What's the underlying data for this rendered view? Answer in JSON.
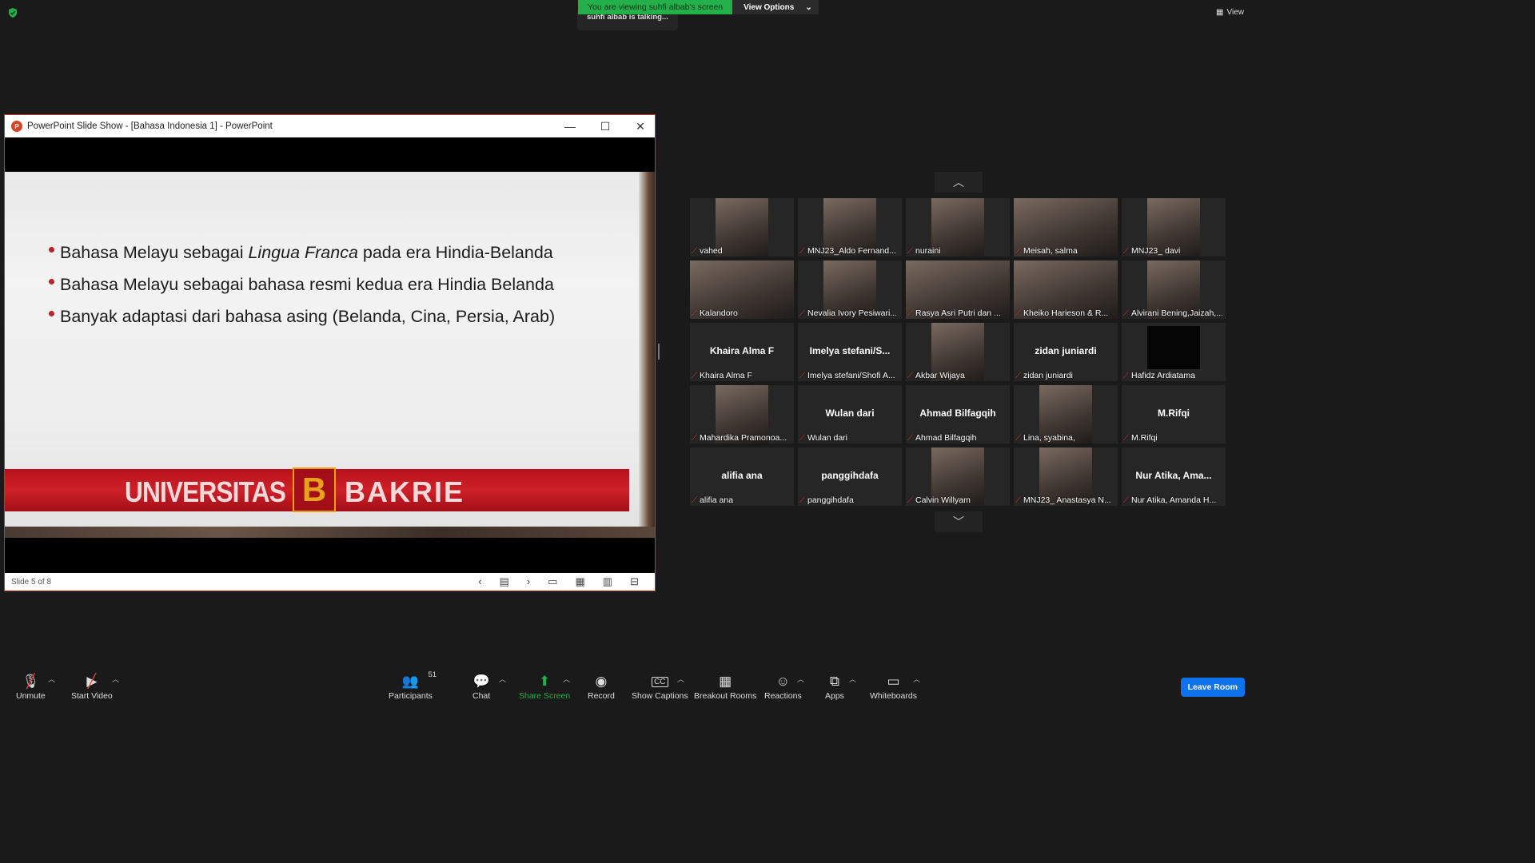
{
  "colors": {
    "share_green": "#23b04a",
    "leave_blue": "#0e72ed",
    "mute_red": "#e0443c",
    "bg": "#1a1a1a"
  },
  "top": {
    "viewing_text": "You are viewing suhfi albab's screen",
    "view_options": "View Options",
    "talking_text": "suhfi albab is talking...",
    "view_label": "View"
  },
  "ppt": {
    "title": "PowerPoint Slide Show - [Bahasa Indonesia 1] - PowerPoint",
    "logo_letter": "P",
    "slide_status": "Slide 5 of 8",
    "bullets": [
      {
        "pre": "Bahasa Melayu sebagai ",
        "italic": "Lingua Franca",
        "post": " pada era Hindia-Belanda"
      },
      {
        "pre": "Bahasa Melayu sebagai bahasa  resmi kedua era Hindia Belanda",
        "italic": "",
        "post": ""
      },
      {
        "pre": "Banyak adaptasi dari bahasa asing (Belanda, Cina, Persia, Arab)",
        "italic": "",
        "post": ""
      }
    ],
    "banner_left": "UNIVERSITAS",
    "banner_logo": "B",
    "banner_right": "BAKRIE"
  },
  "participants": [
    {
      "label": "vahed",
      "video": true
    },
    {
      "label": "MNJ23_Aldo Fernand...",
      "video": true
    },
    {
      "label": "nuraini",
      "video": true
    },
    {
      "label": "Meisah, salma",
      "video": true,
      "wide": true
    },
    {
      "label": "MNJ23_ davi",
      "video": true
    },
    {
      "label": "Kalandoro",
      "video": true,
      "wide": true
    },
    {
      "label": "Nevalia Ivory Pesiwari...",
      "video": true
    },
    {
      "label": "Rasya Asri Putri dan ...",
      "video": true,
      "wide": true
    },
    {
      "label": "Kheiko Harieson & R...",
      "video": true,
      "wide": true
    },
    {
      "label": "Alvirani Bening,Jaizah,...",
      "video": true
    },
    {
      "label": "Khaira Alma F",
      "name": "Khaira Alma F"
    },
    {
      "label": "Imelya stefani/Shofi A...",
      "name": "Imelya  stefani/S..."
    },
    {
      "label": "Akbar Wijaya",
      "video": true
    },
    {
      "label": "zidan juniardi",
      "name": "zidan juniardi"
    },
    {
      "label": "Hafidz Ardiatama",
      "black": true
    },
    {
      "label": "Mahardika Pramonoa...",
      "video": true
    },
    {
      "label": "Wulan dari",
      "name": "Wulan dari"
    },
    {
      "label": "Ahmad Bilfagqih",
      "name": "Ahmad Bilfagqih"
    },
    {
      "label": "Lina, syabina,",
      "video": true
    },
    {
      "label": "M.Rifqi",
      "name": "M.Rifqi"
    },
    {
      "label": "alifia ana",
      "name": "alifia ana"
    },
    {
      "label": "panggihdafa",
      "name": "panggihdafa"
    },
    {
      "label": "Calvin Willyam",
      "video": true
    },
    {
      "label": "MNJ23_ Anastasya N...",
      "video": true
    },
    {
      "label": "Nur Atika, Amanda H...",
      "name": "Nur Atika, Ama..."
    }
  ],
  "toolbar": {
    "unmute": "Unmute",
    "start_video": "Start Video",
    "participants": "Participants",
    "participants_count": "51",
    "chat": "Chat",
    "share_screen": "Share Screen",
    "record": "Record",
    "show_captions": "Show Captions",
    "breakout_rooms": "Breakout Rooms",
    "reactions": "Reactions",
    "apps": "Apps",
    "whiteboards": "Whiteboards",
    "leave": "Leave Room"
  }
}
